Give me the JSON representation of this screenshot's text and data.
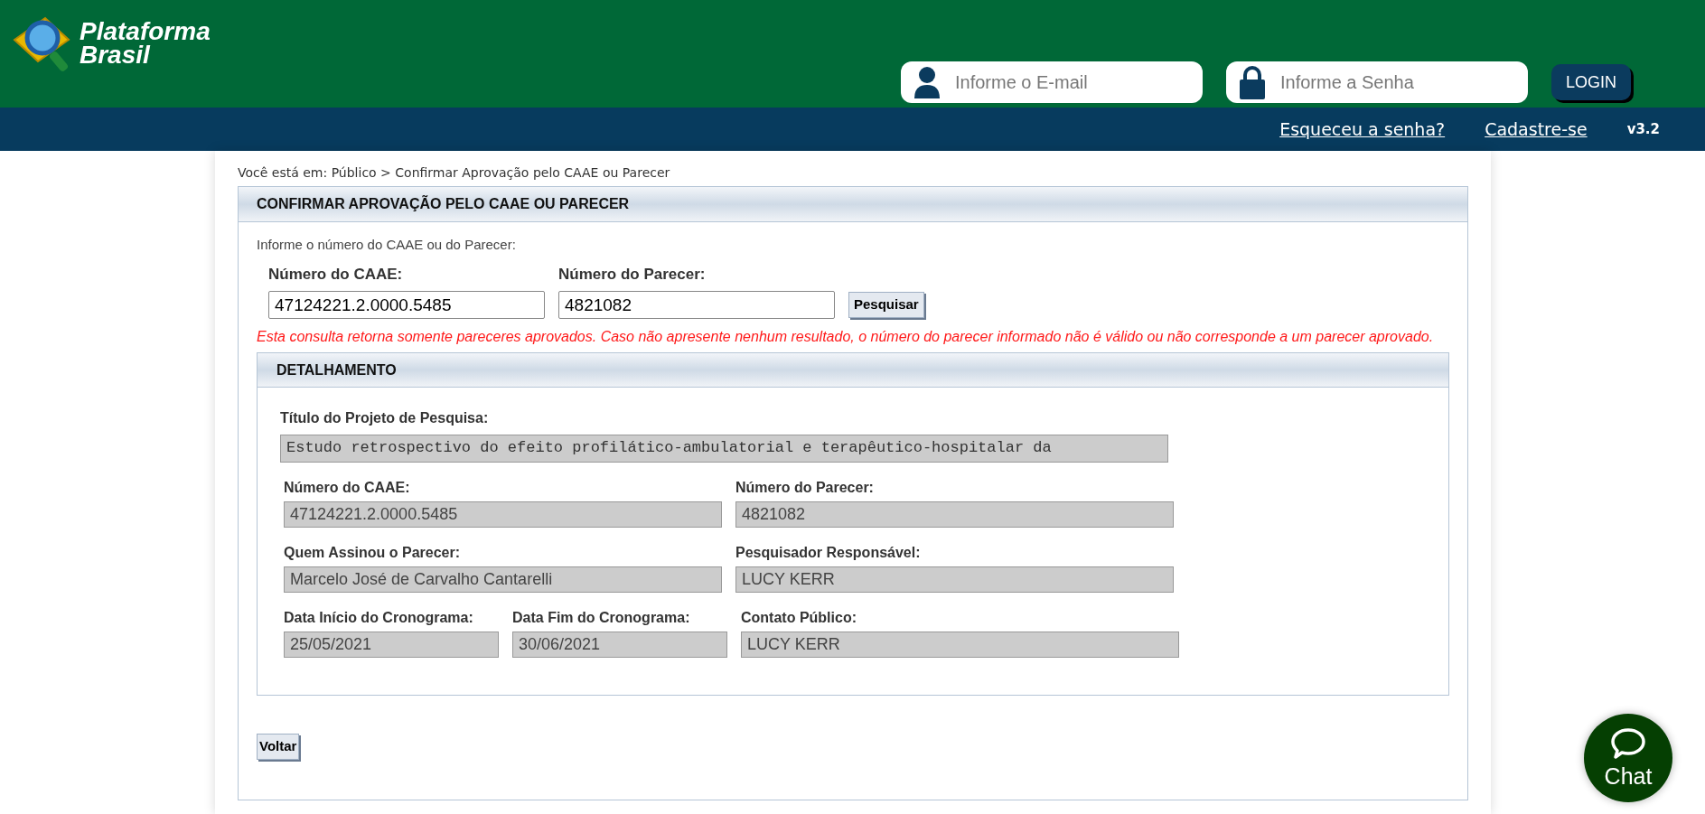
{
  "header": {
    "logo": {
      "line1": "Plataforma",
      "line2": "Brasil"
    },
    "email_field": {
      "placeholder": "Informe o E-mail"
    },
    "password_field": {
      "placeholder": "Informe a Senha"
    },
    "login_button": "LOGIN",
    "links": [
      "Esqueceu a senha?",
      "Cadastre-se"
    ],
    "version": "v3.2"
  },
  "breadcrumb": "Você está em: Público > Confirmar Aprovação pelo CAAE ou Parecer",
  "search_panel": {
    "title": "CONFIRMAR APROVAÇÃO PELO CAAE OU PARECER",
    "instruction": "Informe o número do CAAE ou do Parecer:",
    "fields": [
      {
        "label": "Número do CAAE:",
        "value": "47124221.2.0000.5485"
      },
      {
        "label": "Número do Parecer:",
        "value": "4821082"
      }
    ],
    "search_button": "Pesquisar",
    "warning": "Esta consulta retorna somente pareceres aprovados. Caso não apresente nenhum resultado, o número do parecer informado não é válido ou não corresponde a um parecer aprovado."
  },
  "details": {
    "title": "DETALHAMENTO",
    "project_title": {
      "label": "Título do Projeto de Pesquisa:",
      "value": "Estudo retrospectivo do efeito profilático-ambulatorial e terapêutico-hospitalar da"
    },
    "rows": [
      [
        {
          "label": "Número do CAAE:",
          "value": "47124221.2.0000.5485"
        },
        {
          "label": "Número do Parecer:",
          "value": "4821082"
        }
      ],
      [
        {
          "label": "Quem Assinou o Parecer:",
          "value": "Marcelo José de Carvalho Cantarelli"
        },
        {
          "label": "Pesquisador Responsável:",
          "value": "LUCY KERR"
        }
      ],
      [
        {
          "label": "Data Início do Cronograma:",
          "value": "25/05/2021"
        },
        {
          "label": "Data Fim do Cronograma:",
          "value": "30/06/2021"
        },
        {
          "label": "Contato Público:",
          "value": "LUCY KERR"
        }
      ]
    ]
  },
  "back_button": "Voltar",
  "chat_button": "Chat"
}
